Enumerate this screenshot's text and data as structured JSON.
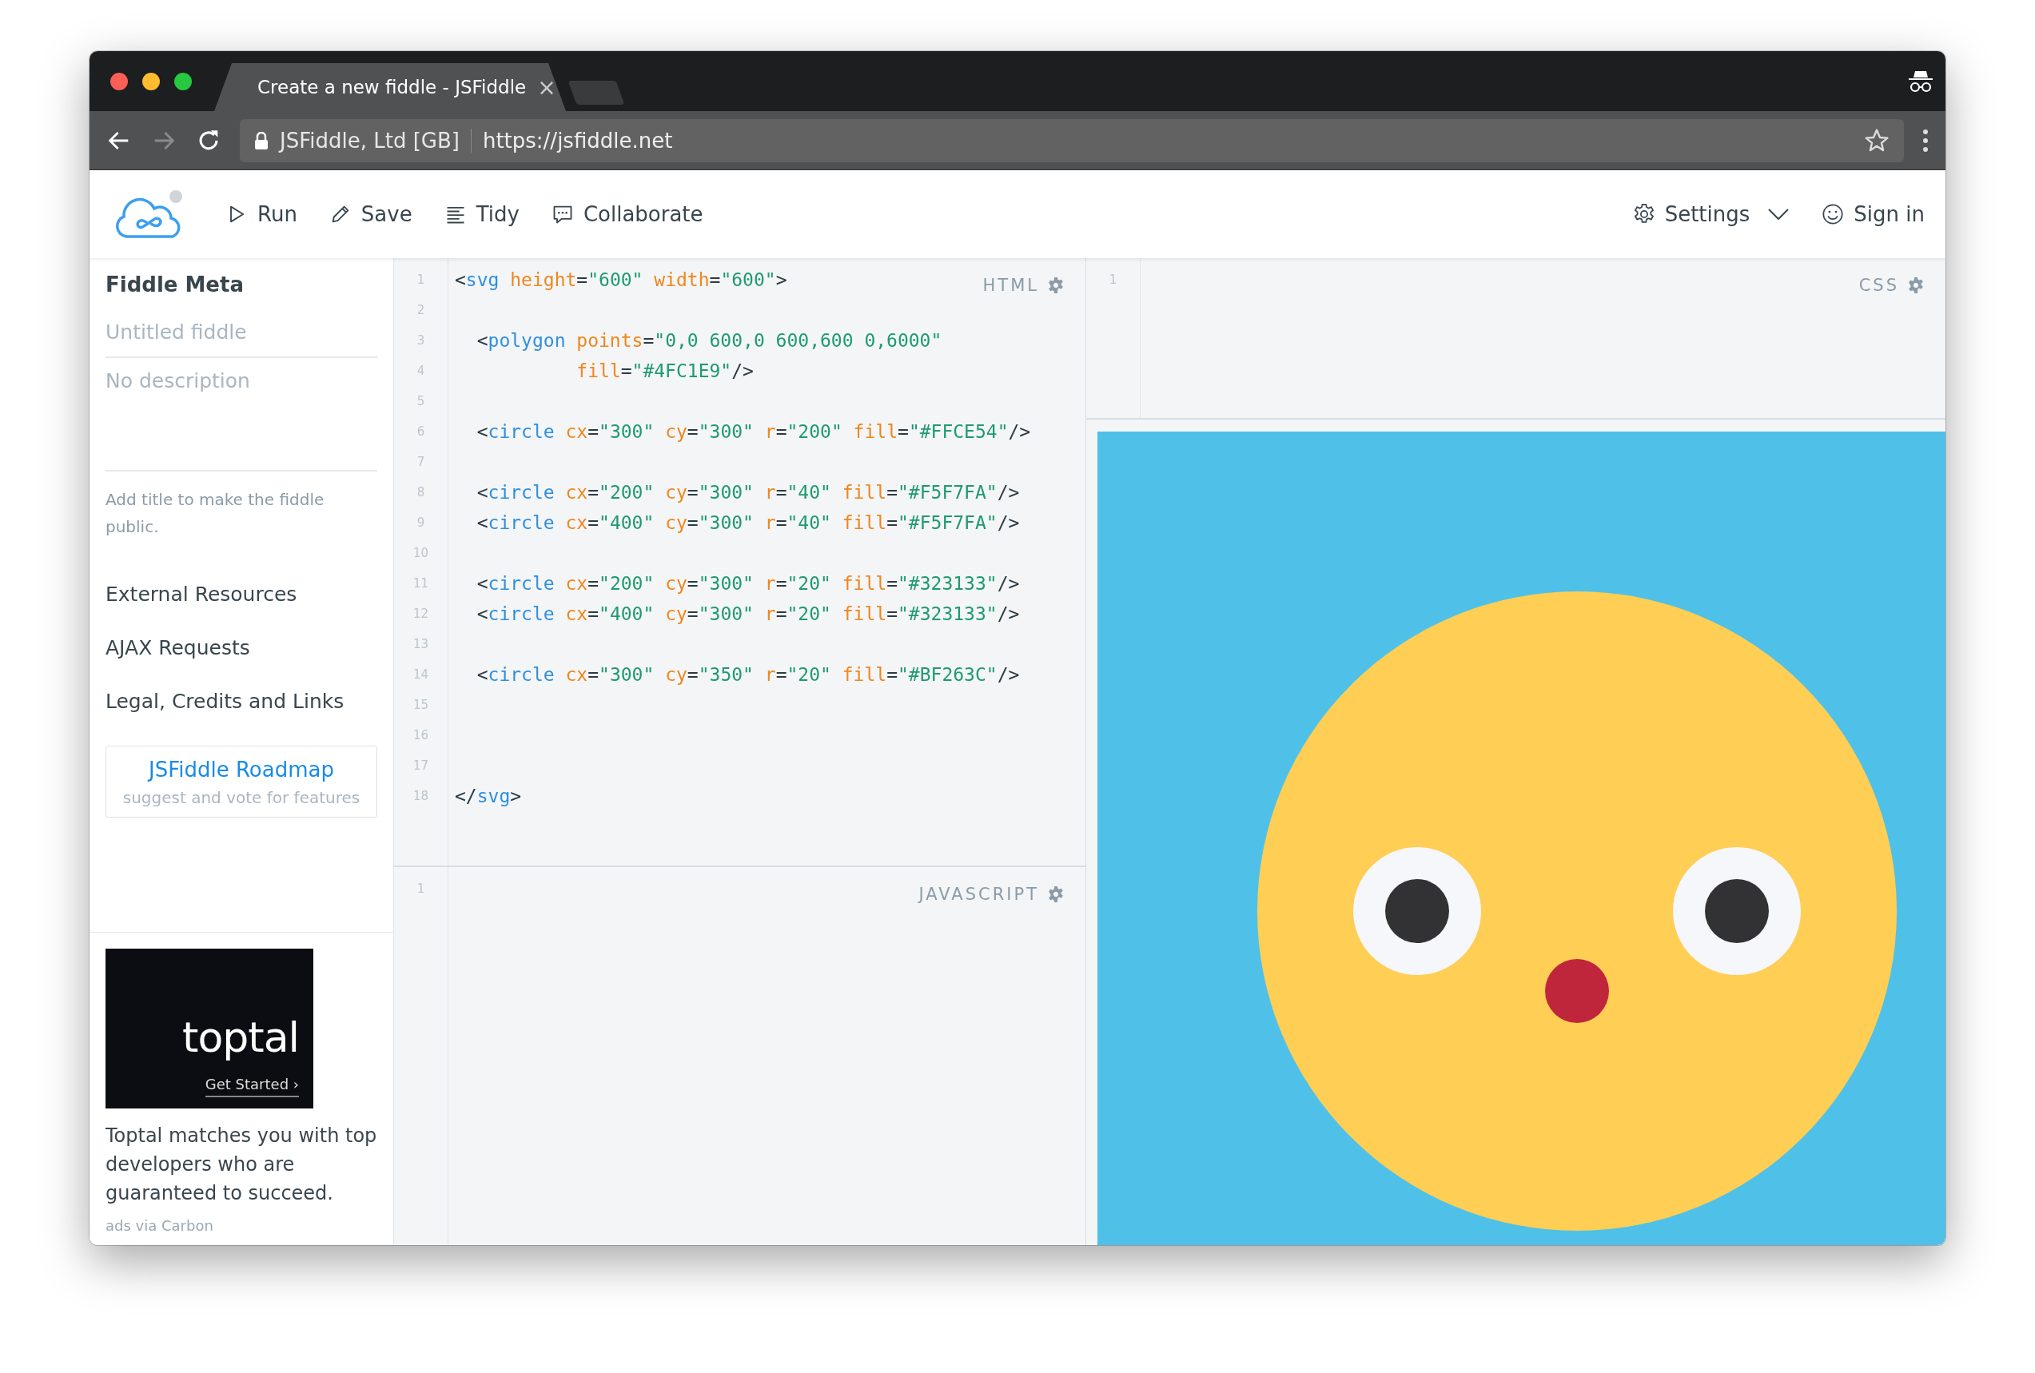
{
  "browser": {
    "tab_title": "Create a new fiddle - JSFiddle",
    "tab_close": "×",
    "site_identity": "JSFiddle, Ltd [GB]",
    "url": "https://jsfiddle.net"
  },
  "toolbar": {
    "actions": [
      {
        "kind": "run",
        "label": "Run"
      },
      {
        "kind": "save",
        "label": "Save"
      },
      {
        "kind": "tidy",
        "label": "Tidy"
      },
      {
        "kind": "collaborate",
        "label": "Collaborate"
      }
    ],
    "settings": "Settings",
    "sign_in": "Sign in"
  },
  "sidebar": {
    "heading": "Fiddle Meta",
    "title_placeholder": "Untitled fiddle",
    "description_placeholder": "No description",
    "hint": "Add title to make the fiddle public.",
    "links": [
      "External Resources",
      "AJAX Requests",
      "Legal, Credits and Links"
    ],
    "roadmap": {
      "title": "JSFiddle Roadmap",
      "subtitle": "suggest and vote for features"
    },
    "ad": {
      "banner_logo": "toptal",
      "banner_cta": "Get Started ›",
      "text": "Toptal matches you with top developers who are guaranteed to succeed.",
      "credit": "ads via Carbon"
    }
  },
  "html_panel": {
    "label": "HTML",
    "lines": [
      {
        "number": "1",
        "tokens": [
          {
            "kind": "punct",
            "text": "<"
          },
          {
            "kind": "tag",
            "text": "svg"
          },
          {
            "kind": "attr",
            "text": " height"
          },
          {
            "kind": "punct",
            "text": "="
          },
          {
            "kind": "value",
            "text": "\"600\""
          },
          {
            "kind": "attr",
            "text": " width"
          },
          {
            "kind": "punct",
            "text": "="
          },
          {
            "kind": "value",
            "text": "\"600\""
          },
          {
            "kind": "punct",
            "text": ">"
          }
        ]
      },
      {
        "number": "2"
      },
      {
        "number": "3",
        "tokens": [
          {
            "kind": "punct",
            "text": "  <"
          },
          {
            "kind": "tag",
            "text": "polygon"
          },
          {
            "kind": "attr",
            "text": " points"
          },
          {
            "kind": "punct",
            "text": "="
          },
          {
            "kind": "value",
            "text": "\"0,0 600,0 600,600 0,6000\""
          }
        ]
      },
      {
        "number": "4",
        "tokens": [
          {
            "kind": "attr",
            "text": "           fill"
          },
          {
            "kind": "punct",
            "text": "="
          },
          {
            "kind": "value",
            "text": "\"#4FC1E9\""
          },
          {
            "kind": "punct",
            "text": "/>"
          }
        ]
      },
      {
        "number": "5"
      },
      {
        "number": "6",
        "tokens": [
          {
            "kind": "punct",
            "text": "  <"
          },
          {
            "kind": "tag",
            "text": "circle"
          },
          {
            "kind": "attr",
            "text": " cx"
          },
          {
            "kind": "punct",
            "text": "="
          },
          {
            "kind": "value",
            "text": "\"300\""
          },
          {
            "kind": "attr",
            "text": " cy"
          },
          {
            "kind": "punct",
            "text": "="
          },
          {
            "kind": "value",
            "text": "\"300\""
          },
          {
            "kind": "attr",
            "text": " r"
          },
          {
            "kind": "punct",
            "text": "="
          },
          {
            "kind": "value",
            "text": "\"200\""
          },
          {
            "kind": "attr",
            "text": " fill"
          },
          {
            "kind": "punct",
            "text": "="
          },
          {
            "kind": "value",
            "text": "\"#FFCE54\""
          },
          {
            "kind": "punct",
            "text": "/>"
          }
        ]
      },
      {
        "number": "7"
      },
      {
        "number": "8",
        "tokens": [
          {
            "kind": "punct",
            "text": "  <"
          },
          {
            "kind": "tag",
            "text": "circle"
          },
          {
            "kind": "attr",
            "text": " cx"
          },
          {
            "kind": "punct",
            "text": "="
          },
          {
            "kind": "value",
            "text": "\"200\""
          },
          {
            "kind": "attr",
            "text": " cy"
          },
          {
            "kind": "punct",
            "text": "="
          },
          {
            "kind": "value",
            "text": "\"300\""
          },
          {
            "kind": "attr",
            "text": " r"
          },
          {
            "kind": "punct",
            "text": "="
          },
          {
            "kind": "value",
            "text": "\"40\""
          },
          {
            "kind": "attr",
            "text": " fill"
          },
          {
            "kind": "punct",
            "text": "="
          },
          {
            "kind": "value",
            "text": "\"#F5F7FA\""
          },
          {
            "kind": "punct",
            "text": "/>"
          }
        ]
      },
      {
        "number": "9",
        "tokens": [
          {
            "kind": "punct",
            "text": "  <"
          },
          {
            "kind": "tag",
            "text": "circle"
          },
          {
            "kind": "attr",
            "text": " cx"
          },
          {
            "kind": "punct",
            "text": "="
          },
          {
            "kind": "value",
            "text": "\"400\""
          },
          {
            "kind": "attr",
            "text": " cy"
          },
          {
            "kind": "punct",
            "text": "="
          },
          {
            "kind": "value",
            "text": "\"300\""
          },
          {
            "kind": "attr",
            "text": " r"
          },
          {
            "kind": "punct",
            "text": "="
          },
          {
            "kind": "value",
            "text": "\"40\""
          },
          {
            "kind": "attr",
            "text": " fill"
          },
          {
            "kind": "punct",
            "text": "="
          },
          {
            "kind": "value",
            "text": "\"#F5F7FA\""
          },
          {
            "kind": "punct",
            "text": "/>"
          }
        ]
      },
      {
        "number": "10"
      },
      {
        "number": "11",
        "tokens": [
          {
            "kind": "punct",
            "text": "  <"
          },
          {
            "kind": "tag",
            "text": "circle"
          },
          {
            "kind": "attr",
            "text": " cx"
          },
          {
            "kind": "punct",
            "text": "="
          },
          {
            "kind": "value",
            "text": "\"200\""
          },
          {
            "kind": "attr",
            "text": " cy"
          },
          {
            "kind": "punct",
            "text": "="
          },
          {
            "kind": "value",
            "text": "\"300\""
          },
          {
            "kind": "attr",
            "text": " r"
          },
          {
            "kind": "punct",
            "text": "="
          },
          {
            "kind": "value",
            "text": "\"20\""
          },
          {
            "kind": "attr",
            "text": " fill"
          },
          {
            "kind": "punct",
            "text": "="
          },
          {
            "kind": "value",
            "text": "\"#323133\""
          },
          {
            "kind": "punct",
            "text": "/>"
          }
        ]
      },
      {
        "number": "12",
        "tokens": [
          {
            "kind": "punct",
            "text": "  <"
          },
          {
            "kind": "tag",
            "text": "circle"
          },
          {
            "kind": "attr",
            "text": " cx"
          },
          {
            "kind": "punct",
            "text": "="
          },
          {
            "kind": "value",
            "text": "\"400\""
          },
          {
            "kind": "attr",
            "text": " cy"
          },
          {
            "kind": "punct",
            "text": "="
          },
          {
            "kind": "value",
            "text": "\"300\""
          },
          {
            "kind": "attr",
            "text": " r"
          },
          {
            "kind": "punct",
            "text": "="
          },
          {
            "kind": "value",
            "text": "\"20\""
          },
          {
            "kind": "attr",
            "text": " fill"
          },
          {
            "kind": "punct",
            "text": "="
          },
          {
            "kind": "value",
            "text": "\"#323133\""
          },
          {
            "kind": "punct",
            "text": "/>"
          }
        ]
      },
      {
        "number": "13"
      },
      {
        "number": "14",
        "tokens": [
          {
            "kind": "punct",
            "text": "  <"
          },
          {
            "kind": "tag",
            "text": "circle"
          },
          {
            "kind": "attr",
            "text": " cx"
          },
          {
            "kind": "punct",
            "text": "="
          },
          {
            "kind": "value",
            "text": "\"300\""
          },
          {
            "kind": "attr",
            "text": " cy"
          },
          {
            "kind": "punct",
            "text": "="
          },
          {
            "kind": "value",
            "text": "\"350\""
          },
          {
            "kind": "attr",
            "text": " r"
          },
          {
            "kind": "punct",
            "text": "="
          },
          {
            "kind": "value",
            "text": "\"20\""
          },
          {
            "kind": "attr",
            "text": " fill"
          },
          {
            "kind": "punct",
            "text": "="
          },
          {
            "kind": "value",
            "text": "\"#BF263C\""
          },
          {
            "kind": "punct",
            "text": "/>"
          }
        ]
      },
      {
        "number": "15"
      },
      {
        "number": "16"
      },
      {
        "number": "17"
      },
      {
        "number": "18",
        "tokens": [
          {
            "kind": "punct",
            "text": "</"
          },
          {
            "kind": "tag",
            "text": "svg"
          },
          {
            "kind": "punct",
            "text": ">"
          }
        ]
      }
    ]
  },
  "css_panel": {
    "label": "CSS",
    "lines": [
      {
        "number": "1"
      }
    ]
  },
  "js_panel": {
    "label": "JAVASCRIPT",
    "lines": [
      {
        "number": "1"
      }
    ]
  }
}
